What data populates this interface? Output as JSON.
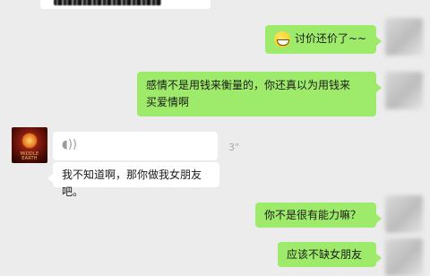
{
  "messages": [
    {
      "side": "right",
      "type": "text",
      "emoji": "grin-emoji",
      "text": "讨价还价了~~"
    },
    {
      "side": "right",
      "type": "text",
      "line1": "感情不是用钱来衡量的，你还真以为用钱来",
      "line2": "买爱情啊"
    },
    {
      "side": "left",
      "type": "voice",
      "duration": "3\""
    },
    {
      "side": "left",
      "type": "text",
      "text": "我不知道啊，那你做我女朋友吧。"
    },
    {
      "side": "right",
      "type": "text",
      "text": "你不是很有能力嘛？"
    },
    {
      "side": "right",
      "type": "text",
      "text": "应该不缺女朋友"
    }
  ],
  "icons": {
    "voice": "voice-wave-icon",
    "emoji": "grin-emoji-icon"
  },
  "colors": {
    "background": "#ececec",
    "green_bubble": "#9eea6a",
    "white_bubble": "#ffffff"
  }
}
